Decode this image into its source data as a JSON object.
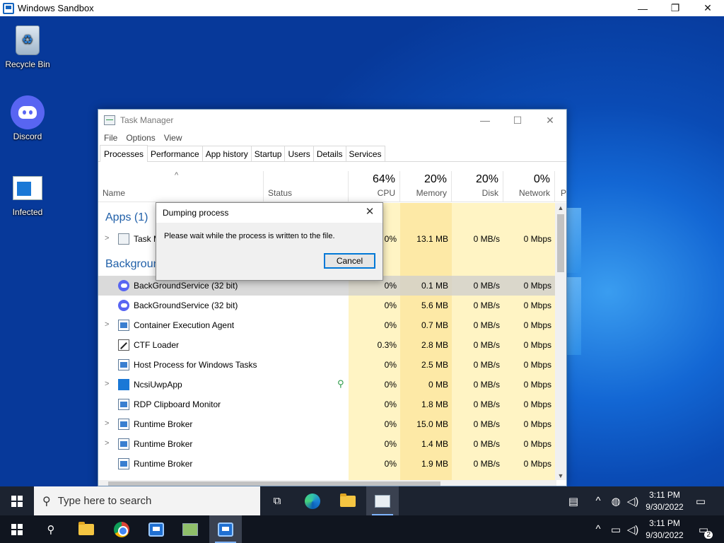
{
  "host_window": {
    "title": "Windows Sandbox",
    "controls": [
      "—",
      "❐",
      "✕"
    ]
  },
  "desktop_icons": [
    {
      "label": "Recycle Bin",
      "icon": "recycle-bin-icon"
    },
    {
      "label": "Discord",
      "icon": "discord-icon"
    },
    {
      "label": "Infected",
      "icon": "infected-file-icon"
    }
  ],
  "task_manager": {
    "title": "Task Manager",
    "controls": [
      "—",
      "☐",
      "✕"
    ],
    "menu": [
      "File",
      "Options",
      "View"
    ],
    "tabs": [
      "Processes",
      "Performance",
      "App history",
      "Startup",
      "Users",
      "Details",
      "Services"
    ],
    "active_tab": "Processes",
    "columns": {
      "name": "Name",
      "status": "Status",
      "cpu": {
        "label": "CPU",
        "pct": "64%"
      },
      "memory": {
        "label": "Memory",
        "pct": "20%"
      },
      "disk": {
        "label": "Disk",
        "pct": "20%"
      },
      "network": {
        "label": "Network",
        "pct": "0%"
      },
      "extra": "P"
    },
    "groups": {
      "apps": "Apps (1)",
      "background": "Background processes (23)"
    },
    "app_rows": [
      {
        "name": "Task Manager",
        "cpu": "0%",
        "memory": "13.1 MB",
        "disk": "0 MB/s",
        "network": "0 Mbps"
      }
    ],
    "background_rows": [
      {
        "name": "BackGroundService (32 bit)",
        "cpu": "0%",
        "memory": "0.1 MB",
        "disk": "0 MB/s",
        "network": "0 Mbps",
        "icon": "discord",
        "expander": false,
        "selected": true
      },
      {
        "name": "BackGroundService (32 bit)",
        "cpu": "0%",
        "memory": "5.6 MB",
        "disk": "0 MB/s",
        "network": "0 Mbps",
        "icon": "discord",
        "expander": false
      },
      {
        "name": "Container Execution Agent",
        "cpu": "0%",
        "memory": "0.7 MB",
        "disk": "0 MB/s",
        "network": "0 Mbps",
        "icon": "window",
        "expander": true
      },
      {
        "name": "CTF Loader",
        "cpu": "0.3%",
        "memory": "2.8 MB",
        "disk": "0 MB/s",
        "network": "0 Mbps",
        "icon": "pen",
        "expander": false
      },
      {
        "name": "Host Process for Windows Tasks",
        "cpu": "0%",
        "memory": "2.5 MB",
        "disk": "0 MB/s",
        "network": "0 Mbps",
        "icon": "window",
        "expander": false
      },
      {
        "name": "NcsiUwpApp",
        "cpu": "0%",
        "memory": "0 MB",
        "disk": "0 MB/s",
        "network": "0 Mbps",
        "icon": "blue",
        "expander": true,
        "leaf": true
      },
      {
        "name": "RDP Clipboard Monitor",
        "cpu": "0%",
        "memory": "1.8 MB",
        "disk": "0 MB/s",
        "network": "0 Mbps",
        "icon": "window",
        "expander": false
      },
      {
        "name": "Runtime Broker",
        "cpu": "0%",
        "memory": "15.0 MB",
        "disk": "0 MB/s",
        "network": "0 Mbps",
        "icon": "window",
        "expander": true
      },
      {
        "name": "Runtime Broker",
        "cpu": "0%",
        "memory": "1.4 MB",
        "disk": "0 MB/s",
        "network": "0 Mbps",
        "icon": "window",
        "expander": true
      },
      {
        "name": "Runtime Broker",
        "cpu": "0%",
        "memory": "1.9 MB",
        "disk": "0 MB/s",
        "network": "0 Mbps",
        "icon": "window",
        "expander": false
      }
    ]
  },
  "dialog": {
    "title": "Dumping process",
    "message": "Please wait while the process is written to the file.",
    "cancel_label": "Cancel"
  },
  "sandbox_taskbar": {
    "search_placeholder": "Type here to search",
    "time": "3:11 PM",
    "date": "9/30/2022"
  },
  "host_taskbar": {
    "time": "3:11 PM",
    "date": "9/30/2022",
    "notification_count": "2"
  },
  "colors": {
    "accent": "#0078d7",
    "heat_light": "#fff4c4",
    "heat_medium": "#fde9a6",
    "selected_row": "#cdcdcd",
    "group_title": "#1f5fa8"
  }
}
